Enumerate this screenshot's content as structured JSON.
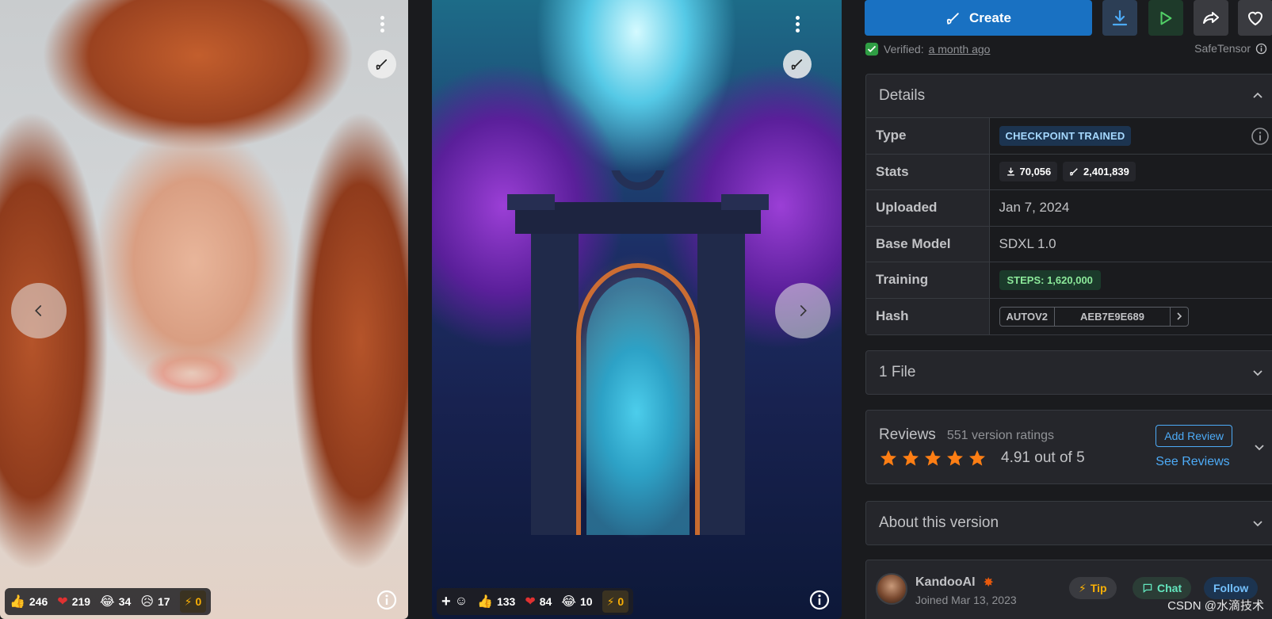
{
  "gallery": {
    "card1": {
      "reactions": {
        "like": "246",
        "heart": "219",
        "laugh": "34",
        "sad": "17",
        "buzz": "0"
      }
    },
    "card2": {
      "reactions": {
        "like": "133",
        "heart": "84",
        "laugh": "10",
        "buzz": "0"
      }
    }
  },
  "actions": {
    "create_label": "Create"
  },
  "verification": {
    "label": "Verified:",
    "when": "a month ago",
    "format": "SafeTensor"
  },
  "details": {
    "title": "Details",
    "rows": {
      "type": {
        "key": "Type",
        "value": "CHECKPOINT TRAINED"
      },
      "stats": {
        "key": "Stats",
        "downloads": "70,056",
        "generations": "2,401,839"
      },
      "uploaded": {
        "key": "Uploaded",
        "value": "Jan 7, 2024"
      },
      "base_model": {
        "key": "Base Model",
        "value": "SDXL 1.0"
      },
      "training": {
        "key": "Training",
        "value": "STEPS: 1,620,000"
      },
      "hash": {
        "key": "Hash",
        "type": "AUTOV2",
        "value": "AEB7E9E689"
      }
    }
  },
  "files": {
    "title": "1 File"
  },
  "reviews": {
    "title": "Reviews",
    "count": "551 version ratings",
    "rating": 4.91,
    "score_text": "4.91 out of 5",
    "add_label": "Add Review",
    "see_label": "See Reviews"
  },
  "about": {
    "title": "About this version"
  },
  "creator": {
    "name": "KandooAI",
    "joined": "Joined Mar 13, 2023",
    "tip_label": "Tip",
    "chat_label": "Chat",
    "follow_label": "Follow"
  },
  "watermark": "CSDN @水滴技术",
  "colors": {
    "accent": "#1971c2",
    "link": "#4dabf7",
    "star": "#fd7e14",
    "verified": "#2f9e44",
    "bg": "#1a1b1e",
    "panel": "#25262b"
  }
}
